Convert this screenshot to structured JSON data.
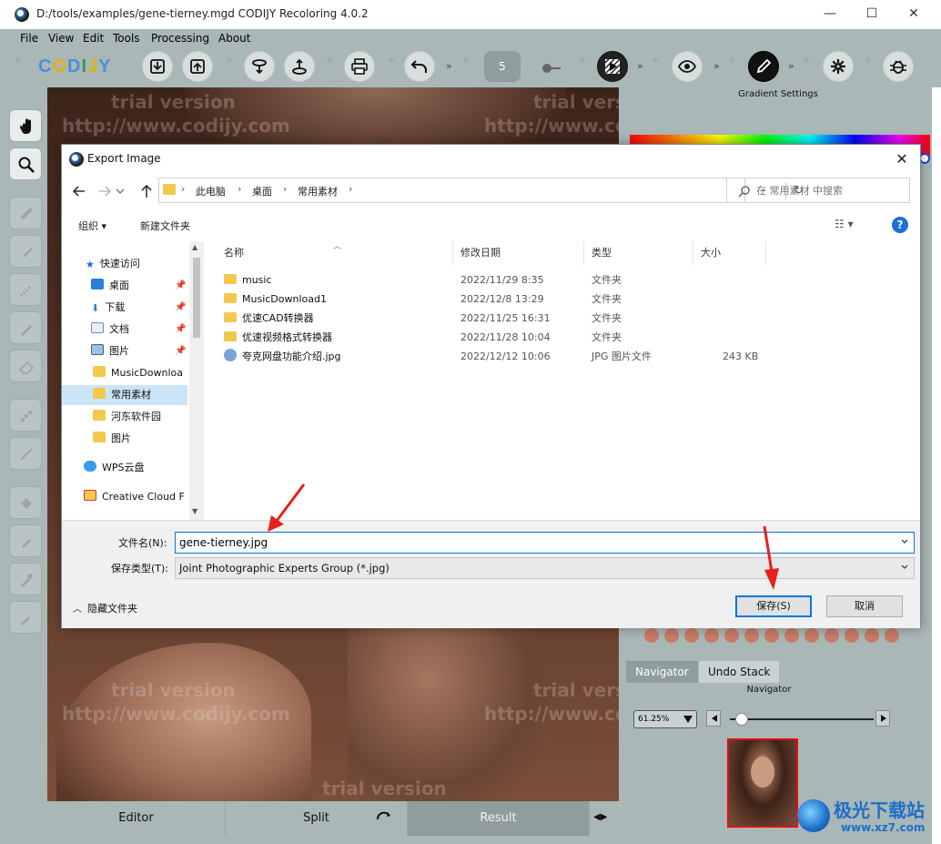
{
  "window": {
    "title": "D:/tools/examples/gene-tierney.mgd CODIJY Recoloring 4.0.2",
    "minimize": "—",
    "maximize": "☐",
    "close": "✕"
  },
  "menu": [
    "File",
    "View",
    "Edit",
    "Tools",
    "Processing",
    "About"
  ],
  "toolbar": {
    "logo": "CODIJY",
    "brush_size": "5",
    "chevron": "»"
  },
  "canvas": {
    "watermarks": [
      "trial version",
      "trial vers",
      "http://www.codijy.com",
      "http://www.co",
      "trial version",
      "trial vers",
      "http://www.codijy.com",
      "http://www.co",
      "trial version"
    ]
  },
  "bottom_tabs": [
    "Editor",
    "Split",
    "Result"
  ],
  "right_panel": {
    "gradient_title": "Gradient Settings",
    "tabs": [
      "Navigator",
      "Undo Stack"
    ],
    "navigator_title": "Navigator",
    "zoom": "61.25%"
  },
  "dialog": {
    "title": "Export Image",
    "close": "✕",
    "breadcrumbs": [
      "此电脑",
      "桌面",
      "常用素材"
    ],
    "search_placeholder": "在 常用素材 中搜索",
    "commands": {
      "organize": "组织 ▾",
      "new_folder": "新建文件夹",
      "help": "?"
    },
    "nav_pane": [
      {
        "label": "快速访问",
        "icon": "star-icon"
      },
      {
        "label": "桌面",
        "icon": "desktop-icon",
        "pinned": true
      },
      {
        "label": "下载",
        "icon": "download-icon",
        "pinned": true
      },
      {
        "label": "文档",
        "icon": "document-icon",
        "pinned": true
      },
      {
        "label": "图片",
        "icon": "picture-icon",
        "pinned": true
      },
      {
        "label": "MusicDownloa",
        "icon": "folder-icon"
      },
      {
        "label": "常用素材",
        "icon": "folder-icon",
        "selected": true
      },
      {
        "label": "河东软件园",
        "icon": "folder-icon"
      },
      {
        "label": "图片",
        "icon": "folder-icon"
      },
      {
        "label": "WPS云盘",
        "icon": "cloud-icon"
      },
      {
        "label": "Creative Cloud F",
        "icon": "creative-cloud-icon"
      }
    ],
    "columns": [
      "名称",
      "修改日期",
      "类型",
      "大小"
    ],
    "files": [
      {
        "name": "music",
        "date": "2022/11/29 8:35",
        "type": "文件夹",
        "size": "",
        "kind": "folder"
      },
      {
        "name": "MusicDownload1",
        "date": "2022/12/8 13:29",
        "type": "文件夹",
        "size": "",
        "kind": "folder"
      },
      {
        "name": "优速CAD转换器",
        "date": "2022/11/25 16:31",
        "type": "文件夹",
        "size": "",
        "kind": "folder"
      },
      {
        "name": "优速视频格式转换器",
        "date": "2022/11/28 10:04",
        "type": "文件夹",
        "size": "",
        "kind": "folder"
      },
      {
        "name": "夸克网盘功能介绍.jpg",
        "date": "2022/12/12 10:06",
        "type": "JPG 图片文件",
        "size": "243 KB",
        "kind": "jpg"
      }
    ],
    "filename_label": "文件名(N):",
    "filename_value": "gene-tierney.jpg",
    "filetype_label": "保存类型(T):",
    "filetype_value": "Joint Photographic Experts Group (*.jpg)",
    "hide_folders": "隐藏文件夹",
    "save": "保存(S)",
    "cancel": "取消"
  },
  "site_logo": {
    "name": "极光下载站",
    "url": "www.xz7.com"
  }
}
